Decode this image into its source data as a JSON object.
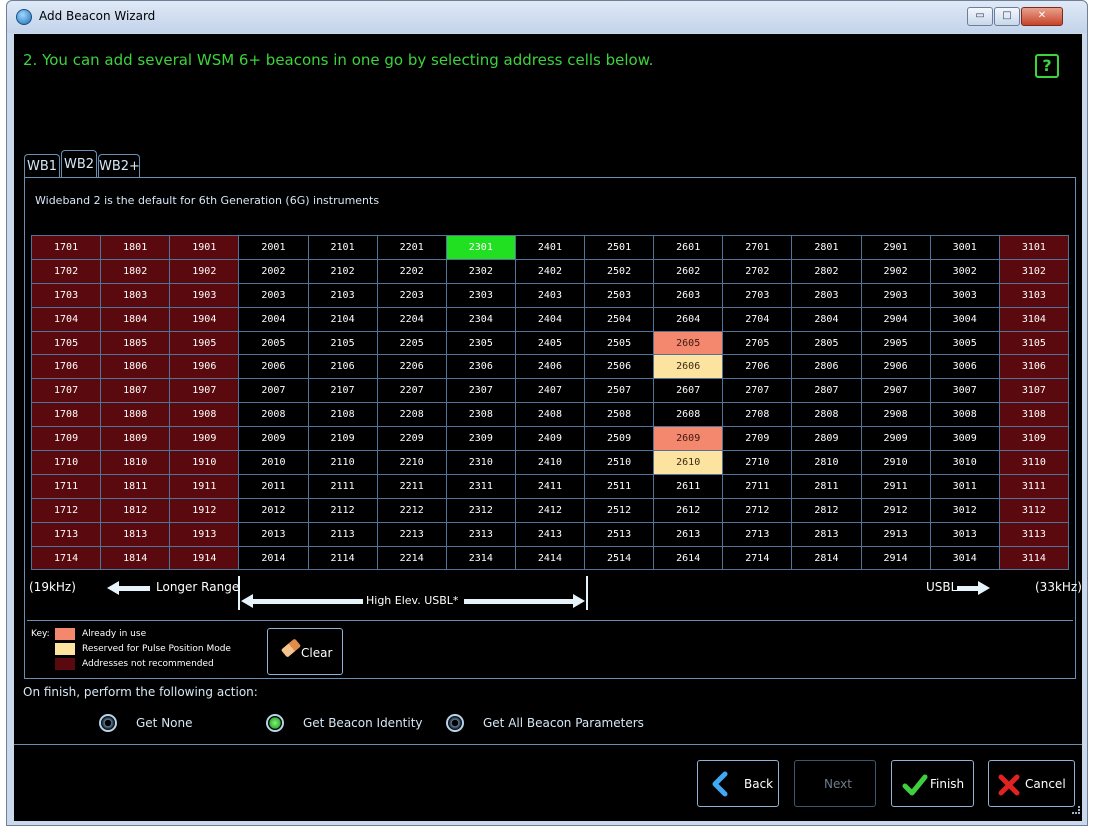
{
  "window": {
    "title": "Add Beacon Wizard",
    "minimize_glyph": "▭",
    "maximize_glyph": "□",
    "close_glyph": "✕"
  },
  "heading": "2. You can add several  WSM 6+ beacons in one go by selecting address cells below.",
  "help_label": "?",
  "tabs": [
    "WB1",
    "WB2",
    "WB2+"
  ],
  "selected_tab": "WB2",
  "panel_description": "Wideband 2 is the default for 6th Generation (6G) instruments",
  "grid": {
    "columns": [
      "17",
      "18",
      "19",
      "20",
      "21",
      "22",
      "23",
      "24",
      "25",
      "26",
      "27",
      "28",
      "29",
      "30",
      "31"
    ],
    "rows": [
      "01",
      "02",
      "03",
      "04",
      "05",
      "06",
      "07",
      "08",
      "09",
      "10",
      "11",
      "12",
      "13",
      "14"
    ],
    "not_recommended_columns": [
      "17",
      "18",
      "19",
      "31"
    ],
    "selected": [
      "2301"
    ],
    "in_use": [
      "2605",
      "2609"
    ],
    "reserved": [
      "2606",
      "2610"
    ]
  },
  "colors": {
    "not_recommended": "#5a0a0e",
    "in_use": "#f4886e",
    "reserved": "#fde3a0",
    "selected": "#21e021",
    "default_cell": "#000000",
    "heading": "#3bd43b"
  },
  "range_labels": {
    "low_freq": "(19kHz)",
    "longer_range": "Longer Range",
    "high_elev": "High Elev. USBL*",
    "usbl": "USBL",
    "high_freq": "(33kHz)"
  },
  "key": {
    "title": "Key:",
    "in_use": "Already in use",
    "reserved": "Reserved for Pulse Position Mode",
    "not_recommended": "Addresses not recommended"
  },
  "clear_button": "Clear",
  "finish_action": {
    "label": "On finish, perform the following action:",
    "options": [
      "Get None",
      "Get Beacon Identity",
      "Get All Beacon Parameters"
    ],
    "selected": "Get Beacon Identity"
  },
  "buttons": {
    "back": "Back",
    "next": "Next",
    "finish": "Finish",
    "cancel": "Cancel"
  },
  "icons": {
    "app": "wizard-icon",
    "clear": "eraser-icon",
    "back": "chevron-left-icon",
    "finish": "checkmark-icon",
    "cancel": "x-icon"
  }
}
